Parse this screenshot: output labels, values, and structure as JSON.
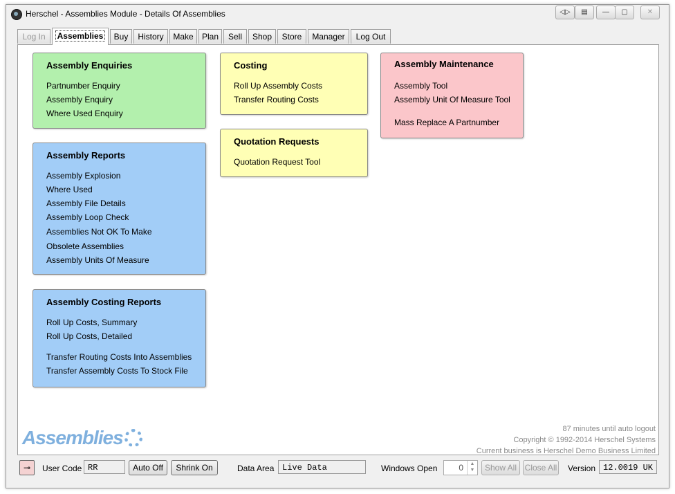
{
  "window": {
    "title": "Herschel - Assemblies Module - Details Of Assemblies",
    "buttons": [
      "◁▷",
      "▤",
      "—",
      "▢",
      "✕"
    ]
  },
  "tabs": [
    {
      "label": "Log In",
      "state": "disabled"
    },
    {
      "label": "Assemblies",
      "state": "active"
    },
    {
      "label": "Buy",
      "state": "normal"
    },
    {
      "label": "History",
      "state": "normal"
    },
    {
      "label": "Make",
      "state": "normal"
    },
    {
      "label": "Plan",
      "state": "normal"
    },
    {
      "label": "Sell",
      "state": "normal"
    },
    {
      "label": "Shop",
      "state": "normal"
    },
    {
      "label": "Store",
      "state": "normal"
    },
    {
      "label": "Manager",
      "state": "normal"
    },
    {
      "label": "Log Out",
      "state": "normal"
    }
  ],
  "panels": {
    "enquiries": {
      "title": "Assembly Enquiries",
      "items": [
        "Partnumber Enquiry",
        "Assembly Enquiry",
        "Where Used Enquiry"
      ]
    },
    "reports": {
      "title": "Assembly Reports",
      "items": [
        "Assembly Explosion",
        "Where Used",
        "Assembly File Details",
        "Assembly Loop Check",
        "Assemblies Not OK To Make",
        "Obsolete Assemblies",
        "Assembly Units Of Measure"
      ]
    },
    "costing_reports": {
      "title": "Assembly Costing Reports",
      "items": [
        "Roll Up Costs, Summary",
        "Roll Up Costs, Detailed",
        "Transfer Routing Costs Into Assemblies",
        "Transfer Assembly Costs To Stock File"
      ]
    },
    "costing": {
      "title": "Costing",
      "items": [
        "Roll Up Assembly Costs",
        "Transfer Routing Costs"
      ]
    },
    "quotation": {
      "title": "Quotation Requests",
      "items": [
        "Quotation Request Tool"
      ]
    },
    "maintenance": {
      "title": "Assembly Maintenance",
      "items": [
        "Assembly Tool",
        "Assembly Unit Of Measure Tool",
        "Mass Replace A Partnumber"
      ]
    }
  },
  "status": {
    "logout": "87 minutes until auto logout",
    "copyright": "Copyright © 1992-2014 Herschel Systems",
    "business": "Current business is Herschel Demo Business Limited",
    "logo_text": "Assemblies"
  },
  "bottombar": {
    "user_code_label": "User Code",
    "user_code_value": "RR",
    "auto_off": "Auto Off",
    "shrink_on": "Shrink On",
    "data_area_label": "Data Area",
    "data_area_value": "Live Data",
    "windows_open_label": "Windows Open",
    "windows_open_value": "0",
    "show_all": "Show All",
    "close_all": "Close All",
    "version_label": "Version",
    "version_value": "12.0019 UK"
  },
  "colors": {
    "green_panel": "#b3f0ad",
    "blue_panel": "#a2cdf7",
    "yellow_panel": "#ffffb5",
    "pink_panel": "#fbc6ca",
    "logo": "#7fb0de"
  }
}
